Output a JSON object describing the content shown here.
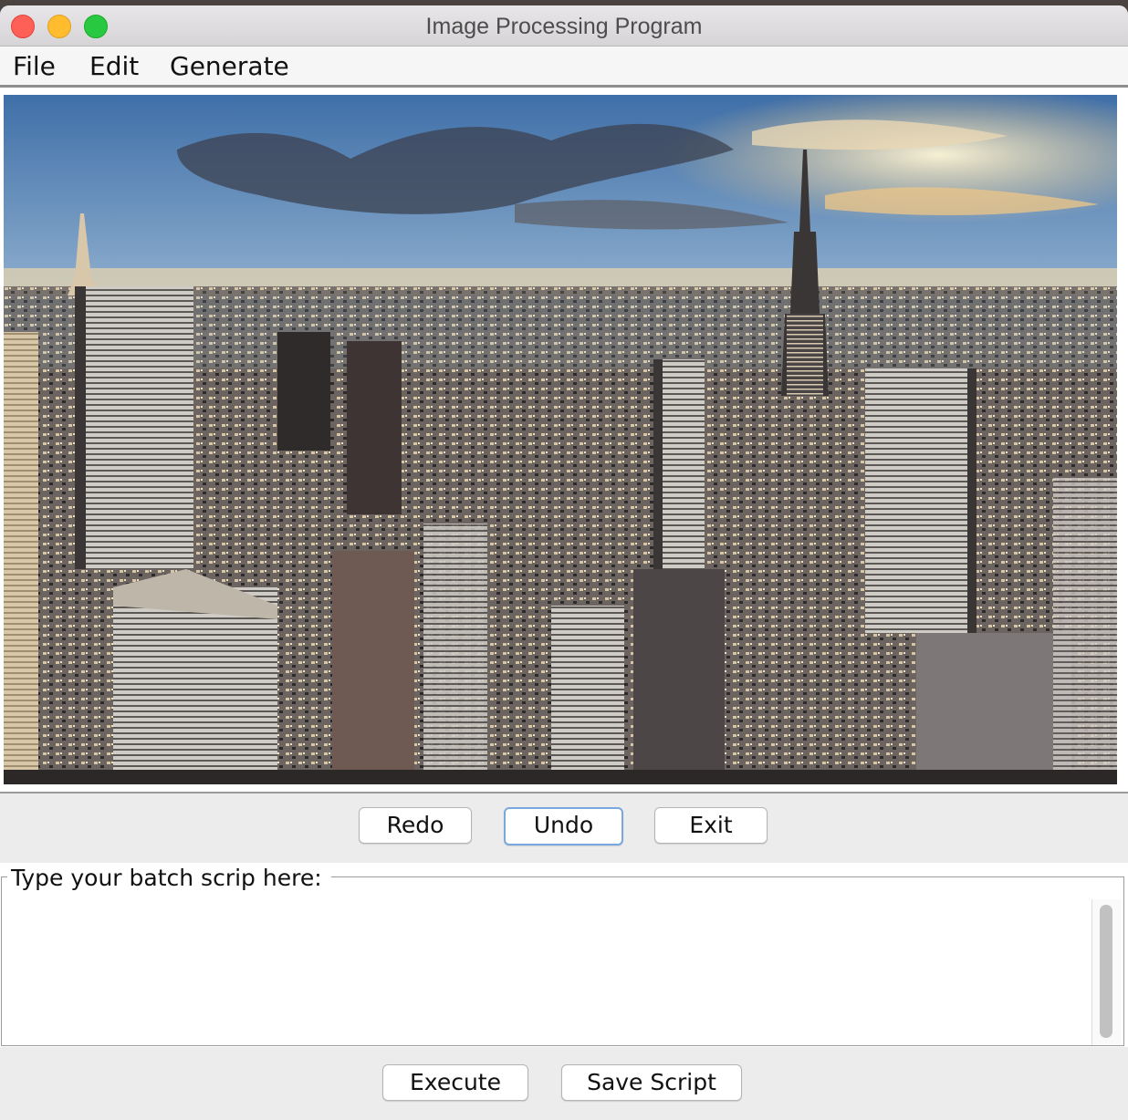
{
  "window": {
    "title": "Image Processing Program"
  },
  "menu": {
    "file": "File",
    "edit": "Edit",
    "generate": "Generate"
  },
  "toolbar": {
    "redo": "Redo",
    "undo": "Undo",
    "exit": "Exit"
  },
  "script": {
    "legend": "Type your batch scrip here:",
    "value": ""
  },
  "actions": {
    "execute": "Execute",
    "save": "Save Script"
  },
  "colors": {
    "close": "#fe5f57",
    "minimize": "#febc2e",
    "maximize": "#28c840",
    "focus_ring": "#7aa7e0"
  }
}
